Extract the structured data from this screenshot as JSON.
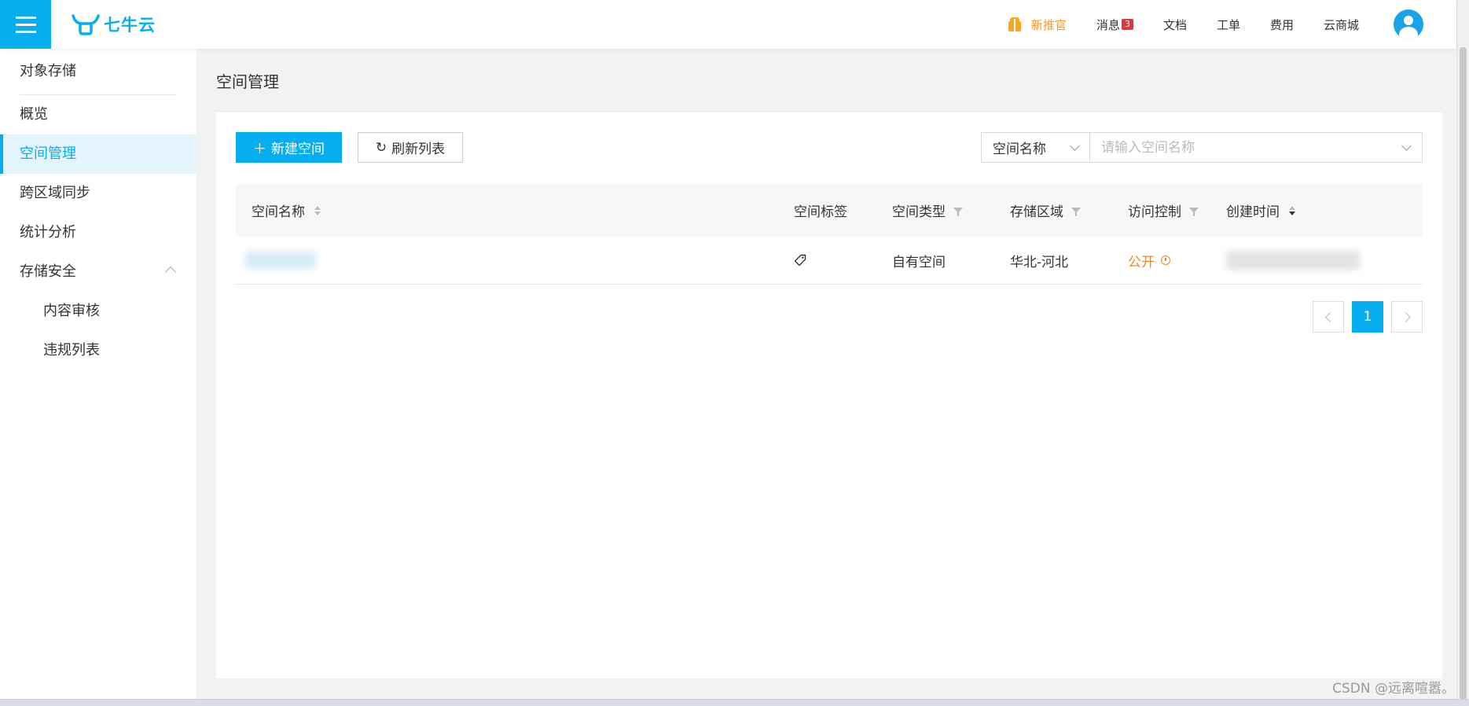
{
  "header": {
    "logo_text": "七牛云",
    "nav": {
      "promo": "新推官",
      "messages": "消息",
      "messages_count": "3",
      "docs": "文档",
      "tickets": "工单",
      "billing": "费用",
      "marketplace": "云商城"
    }
  },
  "sidebar": {
    "title": "对象存储",
    "items": [
      {
        "label": "概览"
      },
      {
        "label": "空间管理"
      },
      {
        "label": "跨区域同步"
      },
      {
        "label": "统计分析"
      },
      {
        "label": "存储安全"
      },
      {
        "label": "内容审核"
      },
      {
        "label": "违规列表"
      }
    ]
  },
  "main": {
    "page_title": "空间管理",
    "new_button": "新建空间",
    "refresh_button": "刷新列表",
    "search": {
      "field_selected": "空间名称",
      "placeholder": "请输入空间名称",
      "value": ""
    },
    "table": {
      "columns": [
        "空间名称",
        "空间标签",
        "空间类型",
        "存储区域",
        "访问控制",
        "创建时间"
      ],
      "rows": [
        {
          "type": "自有空间",
          "region": "华北-河北",
          "access": "公开"
        }
      ]
    },
    "pagination": {
      "current": "1"
    }
  },
  "watermark": "CSDN @远离喧嚣。",
  "colors": {
    "accent": "#06aef0",
    "public": "#f08a1a",
    "badge": "#e2363f",
    "promo": "#f59a23"
  }
}
